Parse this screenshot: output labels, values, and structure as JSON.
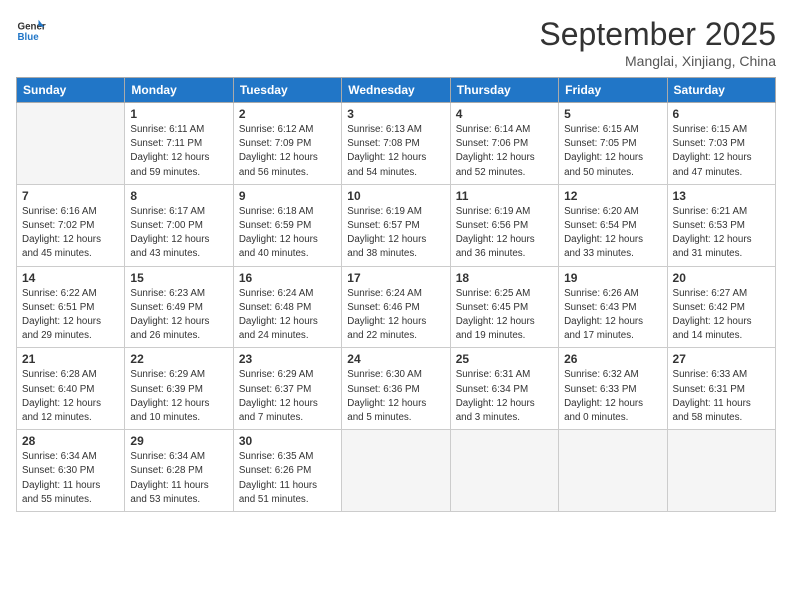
{
  "header": {
    "logo_line1": "General",
    "logo_line2": "Blue",
    "month_title": "September 2025",
    "location": "Manglai, Xinjiang, China"
  },
  "weekdays": [
    "Sunday",
    "Monday",
    "Tuesday",
    "Wednesday",
    "Thursday",
    "Friday",
    "Saturday"
  ],
  "weeks": [
    [
      {
        "day": "",
        "info": ""
      },
      {
        "day": "1",
        "info": "Sunrise: 6:11 AM\nSunset: 7:11 PM\nDaylight: 12 hours\nand 59 minutes."
      },
      {
        "day": "2",
        "info": "Sunrise: 6:12 AM\nSunset: 7:09 PM\nDaylight: 12 hours\nand 56 minutes."
      },
      {
        "day": "3",
        "info": "Sunrise: 6:13 AM\nSunset: 7:08 PM\nDaylight: 12 hours\nand 54 minutes."
      },
      {
        "day": "4",
        "info": "Sunrise: 6:14 AM\nSunset: 7:06 PM\nDaylight: 12 hours\nand 52 minutes."
      },
      {
        "day": "5",
        "info": "Sunrise: 6:15 AM\nSunset: 7:05 PM\nDaylight: 12 hours\nand 50 minutes."
      },
      {
        "day": "6",
        "info": "Sunrise: 6:15 AM\nSunset: 7:03 PM\nDaylight: 12 hours\nand 47 minutes."
      }
    ],
    [
      {
        "day": "7",
        "info": "Sunrise: 6:16 AM\nSunset: 7:02 PM\nDaylight: 12 hours\nand 45 minutes."
      },
      {
        "day": "8",
        "info": "Sunrise: 6:17 AM\nSunset: 7:00 PM\nDaylight: 12 hours\nand 43 minutes."
      },
      {
        "day": "9",
        "info": "Sunrise: 6:18 AM\nSunset: 6:59 PM\nDaylight: 12 hours\nand 40 minutes."
      },
      {
        "day": "10",
        "info": "Sunrise: 6:19 AM\nSunset: 6:57 PM\nDaylight: 12 hours\nand 38 minutes."
      },
      {
        "day": "11",
        "info": "Sunrise: 6:19 AM\nSunset: 6:56 PM\nDaylight: 12 hours\nand 36 minutes."
      },
      {
        "day": "12",
        "info": "Sunrise: 6:20 AM\nSunset: 6:54 PM\nDaylight: 12 hours\nand 33 minutes."
      },
      {
        "day": "13",
        "info": "Sunrise: 6:21 AM\nSunset: 6:53 PM\nDaylight: 12 hours\nand 31 minutes."
      }
    ],
    [
      {
        "day": "14",
        "info": "Sunrise: 6:22 AM\nSunset: 6:51 PM\nDaylight: 12 hours\nand 29 minutes."
      },
      {
        "day": "15",
        "info": "Sunrise: 6:23 AM\nSunset: 6:49 PM\nDaylight: 12 hours\nand 26 minutes."
      },
      {
        "day": "16",
        "info": "Sunrise: 6:24 AM\nSunset: 6:48 PM\nDaylight: 12 hours\nand 24 minutes."
      },
      {
        "day": "17",
        "info": "Sunrise: 6:24 AM\nSunset: 6:46 PM\nDaylight: 12 hours\nand 22 minutes."
      },
      {
        "day": "18",
        "info": "Sunrise: 6:25 AM\nSunset: 6:45 PM\nDaylight: 12 hours\nand 19 minutes."
      },
      {
        "day": "19",
        "info": "Sunrise: 6:26 AM\nSunset: 6:43 PM\nDaylight: 12 hours\nand 17 minutes."
      },
      {
        "day": "20",
        "info": "Sunrise: 6:27 AM\nSunset: 6:42 PM\nDaylight: 12 hours\nand 14 minutes."
      }
    ],
    [
      {
        "day": "21",
        "info": "Sunrise: 6:28 AM\nSunset: 6:40 PM\nDaylight: 12 hours\nand 12 minutes."
      },
      {
        "day": "22",
        "info": "Sunrise: 6:29 AM\nSunset: 6:39 PM\nDaylight: 12 hours\nand 10 minutes."
      },
      {
        "day": "23",
        "info": "Sunrise: 6:29 AM\nSunset: 6:37 PM\nDaylight: 12 hours\nand 7 minutes."
      },
      {
        "day": "24",
        "info": "Sunrise: 6:30 AM\nSunset: 6:36 PM\nDaylight: 12 hours\nand 5 minutes."
      },
      {
        "day": "25",
        "info": "Sunrise: 6:31 AM\nSunset: 6:34 PM\nDaylight: 12 hours\nand 3 minutes."
      },
      {
        "day": "26",
        "info": "Sunrise: 6:32 AM\nSunset: 6:33 PM\nDaylight: 12 hours\nand 0 minutes."
      },
      {
        "day": "27",
        "info": "Sunrise: 6:33 AM\nSunset: 6:31 PM\nDaylight: 11 hours\nand 58 minutes."
      }
    ],
    [
      {
        "day": "28",
        "info": "Sunrise: 6:34 AM\nSunset: 6:30 PM\nDaylight: 11 hours\nand 55 minutes."
      },
      {
        "day": "29",
        "info": "Sunrise: 6:34 AM\nSunset: 6:28 PM\nDaylight: 11 hours\nand 53 minutes."
      },
      {
        "day": "30",
        "info": "Sunrise: 6:35 AM\nSunset: 6:26 PM\nDaylight: 11 hours\nand 51 minutes."
      },
      {
        "day": "",
        "info": ""
      },
      {
        "day": "",
        "info": ""
      },
      {
        "day": "",
        "info": ""
      },
      {
        "day": "",
        "info": ""
      }
    ]
  ]
}
